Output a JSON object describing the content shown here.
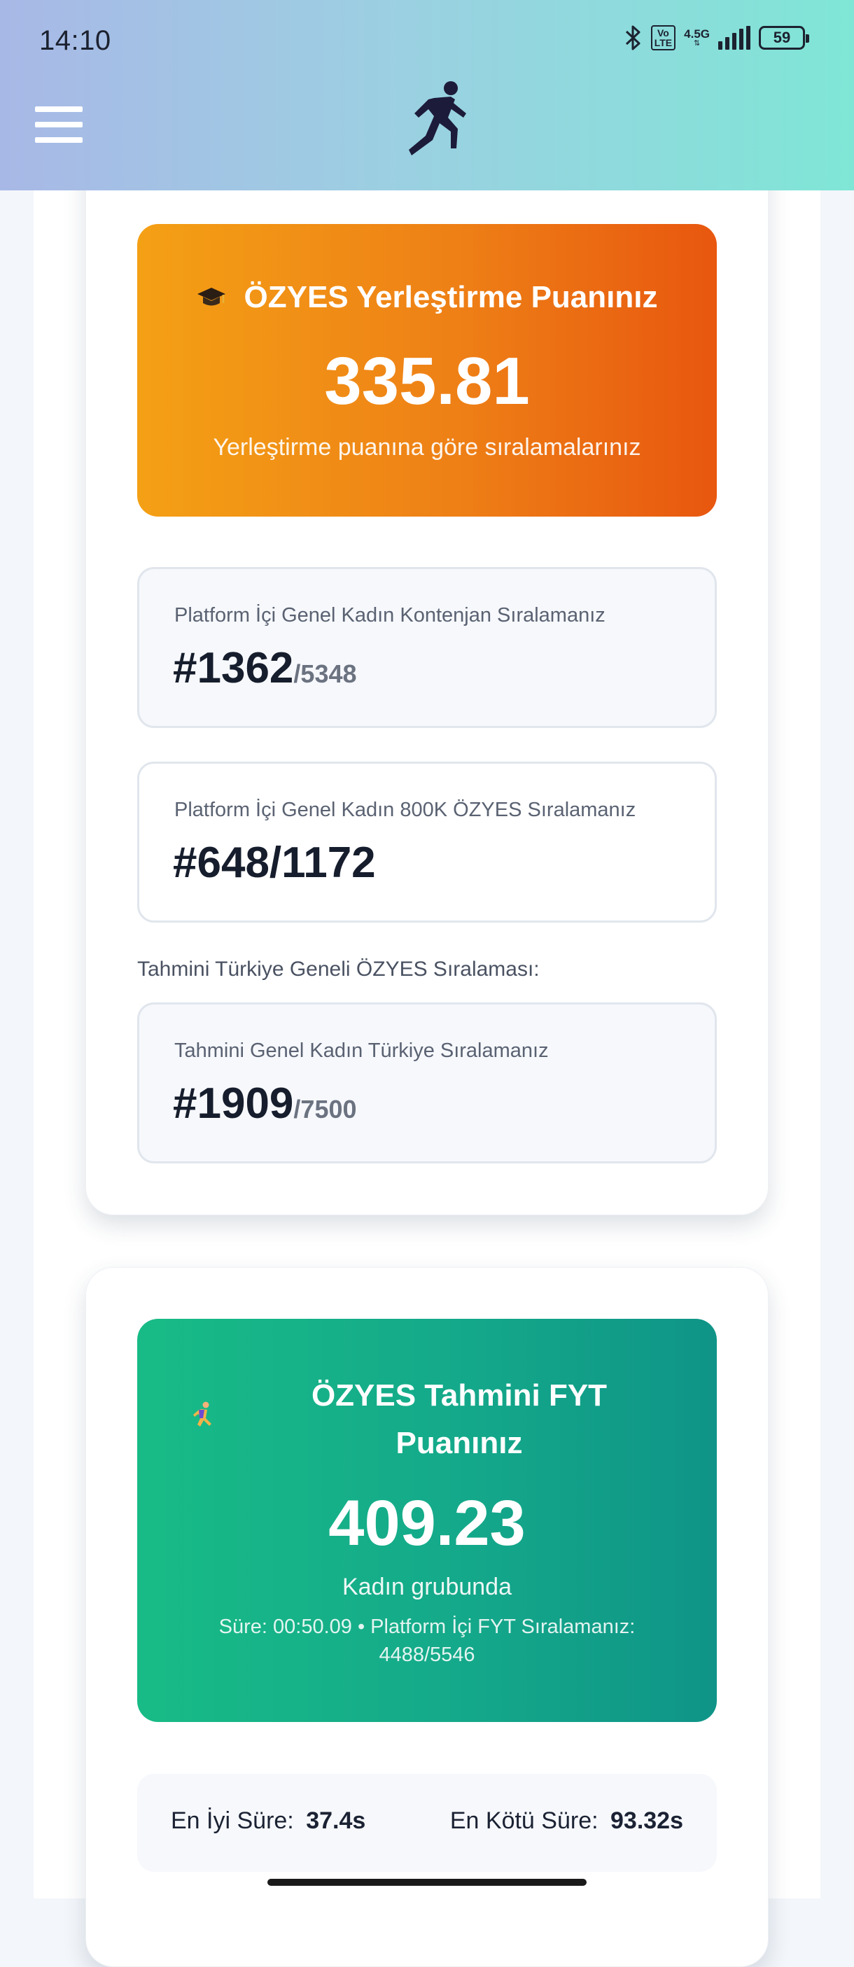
{
  "status_bar": {
    "time": "14:10",
    "network_badge": "Vo LTE",
    "network_type": "4.5G",
    "battery": "59",
    "icons": [
      "bluetooth-icon",
      "volte-icon",
      "signal-icon",
      "battery-icon"
    ]
  },
  "header": {
    "menu_icon": "hamburger-menu-icon",
    "logo_icon": "running-person-logo-icon",
    "colors": {
      "gradient_start": "#a8b8e6",
      "gradient_end": "#7fe6d6"
    }
  },
  "placement_card": {
    "hero": {
      "icon": "graduation-cap-icon",
      "title": "ÖZYES Yerleştirme Puanınız",
      "score": "335.81",
      "subtitle": "Yerleştirme puanına göre sıralamalarınız",
      "colors": {
        "start": "#f4a015",
        "end": "#e8570f"
      }
    },
    "ranks": [
      {
        "label": "Platform İçi Genel Kadın Kontenjan Sıralamanız",
        "value": "#1362",
        "total": "/5348"
      },
      {
        "label": "Platform İçi Genel Kadın 800K ÖZYES Sıralamanız",
        "value": "#648/1172",
        "total": ""
      }
    ],
    "turkey_section_label": "Tahmini Türkiye Geneli ÖZYES Sıralaması:",
    "turkey_rank": {
      "label": "Tahmini Genel Kadın Türkiye Sıralamanız",
      "value": "#1909",
      "total": "/7500"
    }
  },
  "fyt_card": {
    "hero": {
      "icon": "runner-icon",
      "title": "ÖZYES Tahmini FYT Puanınız",
      "score": "409.23",
      "group": "Kadın grubunda",
      "detail": "Süre: 00:50.09 • Platform İçi FYT Sıralamanız: 4488/5546",
      "colors": {
        "start": "#18bb86",
        "end": "#0f9487"
      }
    },
    "times": {
      "best_label": "En İyi Süre:",
      "best_value": "37.4s",
      "worst_label": "En Kötü Süre:",
      "worst_value": "93.32s"
    }
  }
}
